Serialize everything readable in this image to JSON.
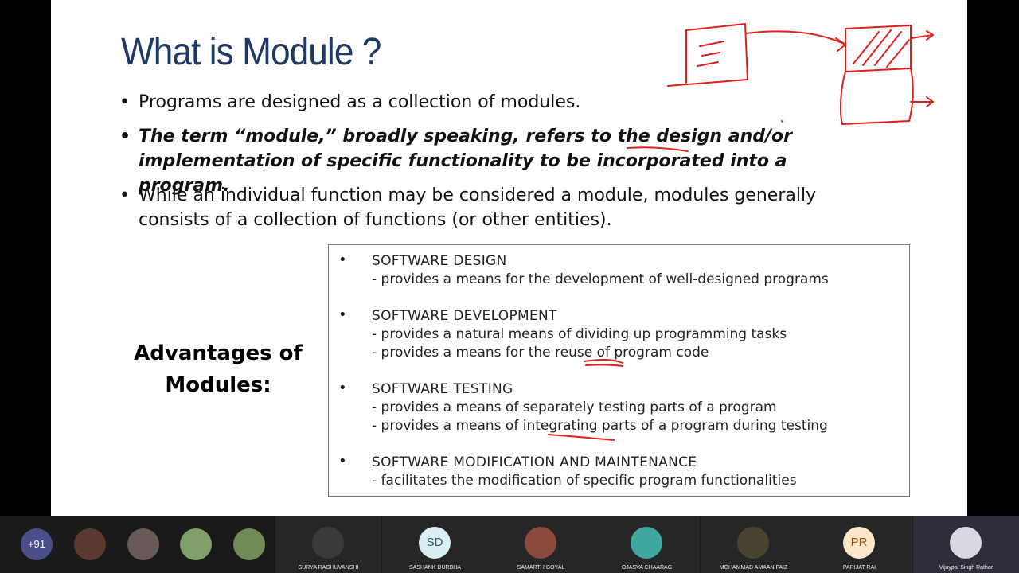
{
  "slide": {
    "title": "What is Module ?",
    "bullets": [
      "Programs are designed as a collection of modules.",
      "The term “module,” broadly speaking, refers to the design and/or implementation of specific functionality to be incorporated into a program.",
      "While an individual function may be considered a module, modules generally consists of a collection of functions (or other entities)."
    ],
    "advantages_heading_line1": "Advantages of",
    "advantages_heading_line2": "Modules:",
    "advantages": [
      {
        "title": "SOFTWARE DESIGN",
        "lines": [
          "- provides a means for the development of well-designed programs"
        ]
      },
      {
        "title": "SOFTWARE DEVELOPMENT",
        "lines": [
          "- provides a natural means of dividing up programming tasks",
          "- provides a means for the reuse of program code"
        ]
      },
      {
        "title": "SOFTWARE TESTING",
        "lines": [
          "- provides a means of separately testing parts of a program",
          "- provides a means of integrating parts of a program during testing"
        ]
      },
      {
        "title": "SOFTWARE MODIFICATION AND MAINTENANCE",
        "lines": [
          "- facilitates the modification of specific program functionalities"
        ]
      }
    ],
    "bullet_glyph": "•",
    "title_color": "#1f3864",
    "annotation_color": "#e0201c"
  },
  "participants": {
    "overflow_count": "+91",
    "overflow_color": "#4a4f8a",
    "tiles": [
      {
        "name": "SURYA RAGHUVANSHI",
        "kind": "photo",
        "color": "#3a3a3a"
      },
      {
        "name": "SASHANK DURBHA",
        "kind": "initials",
        "initials": "SD",
        "color": "#dbeef3",
        "text_color": "#2d5b73"
      },
      {
        "name": "SAMARTH GOYAL",
        "kind": "photo",
        "color": "#8b4a3c"
      },
      {
        "name": "OJASVA CHAARAG",
        "kind": "photo",
        "color": "#3fa7a0"
      },
      {
        "name": "MOHAMMAD AMAAN FAIZ",
        "kind": "photo",
        "color": "#4a4330"
      },
      {
        "name": "PARIJAT RAI",
        "kind": "initials",
        "initials": "PR",
        "color": "#fde7c8",
        "text_color": "#8a5a1c"
      },
      {
        "name": "Vijaypal Singh Rathor",
        "kind": "photo",
        "color": "#d8d8e0"
      }
    ]
  }
}
